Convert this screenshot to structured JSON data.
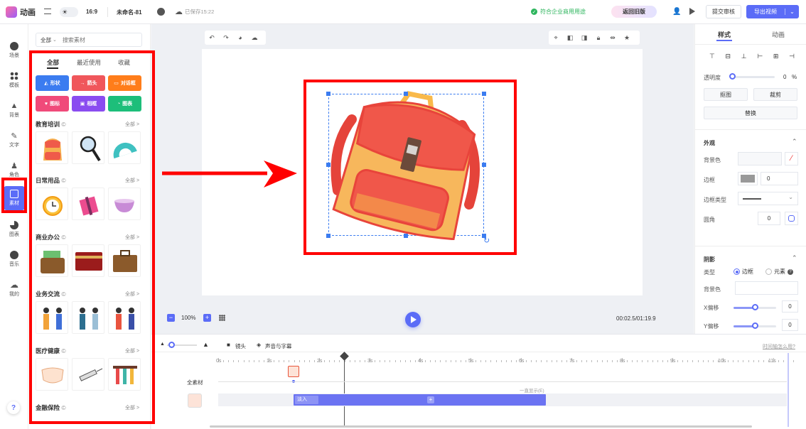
{
  "topbar": {
    "app_name": "动画",
    "aspect": "16:9",
    "doc_name": "未命名-81",
    "saved": "已保存15:22",
    "compliance": "符合企业商用用途",
    "back_old": "返回旧版",
    "submit": "提交审核",
    "export": "导出视频"
  },
  "leftnav": {
    "items": [
      {
        "label": "场景",
        "icon": "scene-icon"
      },
      {
        "label": "模板",
        "icon": "template-icon"
      },
      {
        "label": "背景",
        "icon": "background-icon"
      },
      {
        "label": "文字",
        "icon": "text-icon"
      },
      {
        "label": "角色",
        "icon": "character-icon"
      },
      {
        "label": "素材",
        "icon": "material-icon"
      },
      {
        "label": "图表",
        "icon": "chart-icon"
      },
      {
        "label": "音乐",
        "icon": "music-icon"
      },
      {
        "label": "我的",
        "icon": "cloud-icon"
      }
    ],
    "help": "?"
  },
  "panel": {
    "filter": "全部",
    "search_placeholder": "搜索素材",
    "tabs": [
      "全部",
      "最近使用",
      "收藏"
    ],
    "categories": [
      {
        "label": "形状",
        "color": "#3b7cf0"
      },
      {
        "label": "箭头",
        "color": "#f0565b"
      },
      {
        "label": "对话框",
        "color": "#ff7d1a"
      },
      {
        "label": "图标",
        "color": "#f04a7a"
      },
      {
        "label": "相框",
        "color": "#8a4cf0"
      },
      {
        "label": "图表",
        "color": "#1dbe7a"
      }
    ],
    "sections": [
      {
        "title": "教育培训",
        "all": "全部 >"
      },
      {
        "title": "日常用品",
        "all": "全部 >"
      },
      {
        "title": "商业办公",
        "all": "全部 >"
      },
      {
        "title": "业务交流",
        "all": "全部 >"
      },
      {
        "title": "医疗健康",
        "all": "全部 >"
      },
      {
        "title": "金融保险",
        "all": "全部 >"
      }
    ]
  },
  "canvas": {
    "zoom": "100%",
    "time": "00:02.5/01:19.9"
  },
  "right": {
    "tabs": [
      "样式",
      "动画"
    ],
    "opacity_label": "透明度",
    "opacity_value": "0",
    "opacity_unit": "%",
    "cutout": "抠图",
    "crop": "裁剪",
    "replace": "替换",
    "appearance": "外观",
    "bg_color": "背景色",
    "border": "边框",
    "border_value": "0",
    "border_type": "边框类型",
    "radius": "圆角",
    "radius_value": "0",
    "shadow": "阴影",
    "type": "类型",
    "type_border": "边框",
    "type_element": "元素",
    "shadow_bg": "背景色",
    "x_offset": "X偏移",
    "x_value": "0",
    "y_offset": "Y偏移",
    "y_value": "0"
  },
  "timeline": {
    "lens": "镜头",
    "audio": "声音与字幕",
    "help_link": "时间轴怎么用?",
    "ticks": [
      "0s",
      "1s",
      "2s",
      "3s",
      "4s",
      "5s",
      "6s",
      "7s",
      "8s",
      "9s",
      "10s",
      "11s"
    ],
    "track_label": "全素材",
    "always_show": "一直显示(E)",
    "fade_in": "淡入"
  },
  "colors": {
    "accent": "#5b6cf7",
    "red_box": "#ff0000"
  }
}
